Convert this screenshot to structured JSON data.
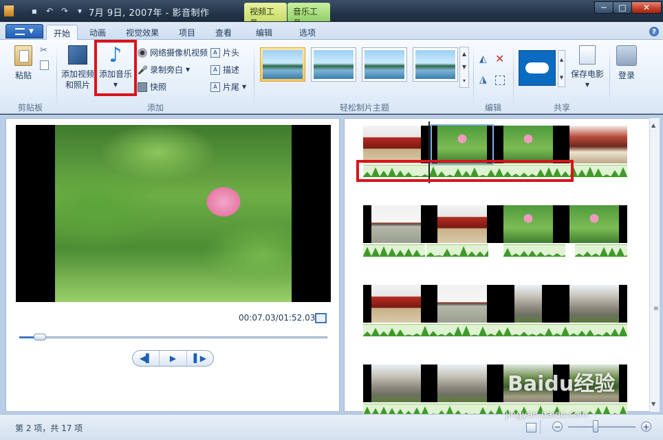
{
  "titlebar": {
    "title": "7月 9日, 2007年 - 影音制作",
    "contextual_tabs": [
      "视频工具",
      "音乐工具"
    ],
    "window_buttons": {
      "minimize": "─",
      "maximize": "□",
      "close": "✕"
    }
  },
  "ribbon_tabs": [
    {
      "label": "开始",
      "active": true
    },
    {
      "label": "动画"
    },
    {
      "label": "视觉效果"
    },
    {
      "label": "项目"
    },
    {
      "label": "查看"
    },
    {
      "label": "编辑"
    },
    {
      "label": "选项"
    }
  ],
  "ribbon": {
    "clipboard": {
      "group_label": "剪贴板",
      "paste": "粘贴"
    },
    "add": {
      "group_label": "添加",
      "add_video_photo_line1": "添加视频",
      "add_video_photo_line2": "和照片",
      "add_music": "添加音乐",
      "webcam_video": "网络摄像机视频",
      "record_narration": "录制旁白",
      "snapshot": "快照",
      "title": "片头",
      "caption": "描述",
      "credits": "片尾"
    },
    "themes": {
      "group_label": "轻松制片主题"
    },
    "editing": {
      "group_label": "编辑"
    },
    "share": {
      "group_label": "共享",
      "save_movie": "保存电影"
    },
    "signin": {
      "label": "登录"
    }
  },
  "preview": {
    "time": "00:07.03/01:52.03",
    "progress": 0.0626,
    "transport": {
      "prev": "◀▌",
      "play": "▶",
      "next": "▌▶"
    }
  },
  "status": {
    "text": "第 2 项，共 17 项",
    "zoom_minus": "−",
    "zoom_plus": "+",
    "zoom_level": 0.4
  },
  "watermark": {
    "brand": "Baidu经验",
    "url": "jingyan.baidu.com"
  },
  "colors": {
    "highlight": "#d8141b",
    "accent": "#3b77c0",
    "music_track": "#3f9a2a"
  }
}
